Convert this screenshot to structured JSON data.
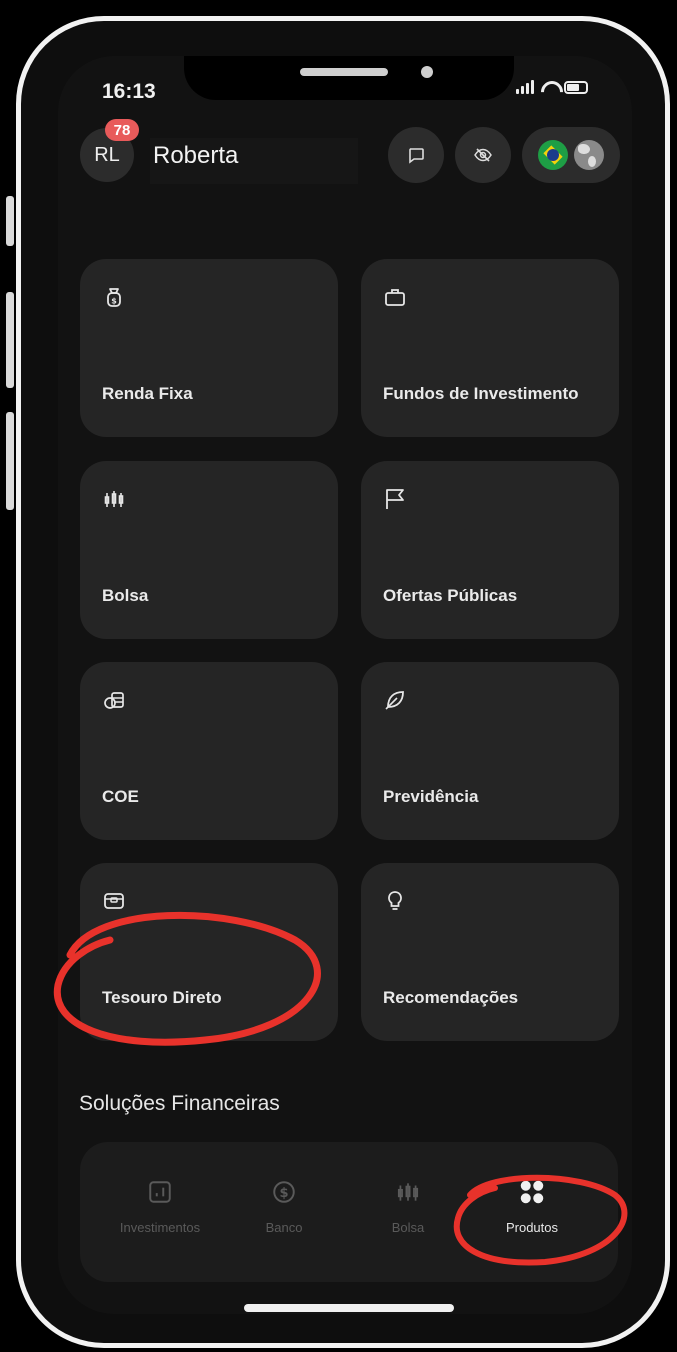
{
  "status_bar": {
    "time": "16:13"
  },
  "header": {
    "avatar_initials": "RL",
    "notification_count": "78",
    "user_name": "Roberta"
  },
  "products": [
    {
      "label": "Renda Fixa",
      "icon": "money-bag-icon"
    },
    {
      "label": "Fundos de Investimento",
      "icon": "briefcase-icon"
    },
    {
      "label": "Bolsa",
      "icon": "candlestick-icon"
    },
    {
      "label": "Ofertas Públicas",
      "icon": "flag-icon"
    },
    {
      "label": "COE",
      "icon": "coins-stack-icon"
    },
    {
      "label": "Previdência",
      "icon": "leaf-icon"
    },
    {
      "label": "Tesouro Direto",
      "icon": "treasury-chest-icon"
    },
    {
      "label": "Recomendações",
      "icon": "lightbulb-icon"
    }
  ],
  "section": {
    "title": "Soluções Financeiras"
  },
  "tabbar": {
    "items": [
      {
        "label": "Investimentos",
        "icon": "chart-icon"
      },
      {
        "label": "Banco",
        "icon": "dollar-coin-icon"
      },
      {
        "label": "Bolsa",
        "icon": "candlestick-icon"
      },
      {
        "label": "Produtos",
        "icon": "grid-dots-icon"
      }
    ],
    "active": "Produtos"
  },
  "colors": {
    "background": "#121212",
    "card": "#252525",
    "annotation_red": "#e8322b",
    "badge": "#e85a5a"
  }
}
